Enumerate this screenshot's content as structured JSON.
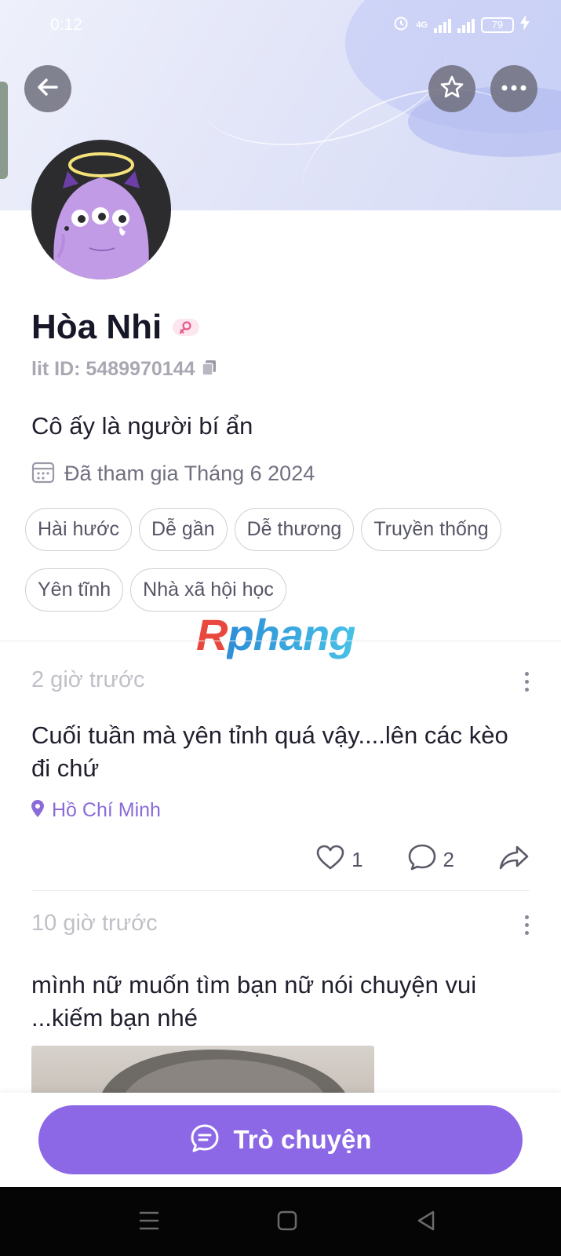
{
  "status_bar": {
    "time": "0:12",
    "network": "4G",
    "battery": "79"
  },
  "header": {
    "back_icon": "arrow-left-icon",
    "favorite_icon": "star-icon",
    "more_icon": "more-horizontal-icon"
  },
  "profile": {
    "name": "Hòa Nhi",
    "gender_icon": "female-icon",
    "lit_id": "lit ID: 5489970144",
    "bio": "Cô ấy là người bí ẩn",
    "joined": "Đã tham gia Tháng 6 2024",
    "tags": [
      "Hài hước",
      "Dễ gần",
      "Dễ thương",
      "Truyền thống",
      "Yên tĩnh",
      "Nhà xã hội học"
    ]
  },
  "watermark": {
    "first": "R",
    "rest": "phang"
  },
  "posts": [
    {
      "time": "2 giờ trước",
      "text": "Cuối tuần mà yên tỉnh quá vậy....lên các kèo đi chứ",
      "location": "Hồ Chí Minh",
      "likes": "1",
      "comments": "2"
    },
    {
      "time": "10 giờ trước",
      "text": "mình nữ muốn tìm bạn nữ nói chuyện vui ...kiếm bạn nhé"
    }
  ],
  "chat_button": {
    "label": "Trò chuyện"
  },
  "colors": {
    "accent": "#8c68e6",
    "location": "#8a6bd8",
    "gender_pink": "#e85a8e"
  }
}
